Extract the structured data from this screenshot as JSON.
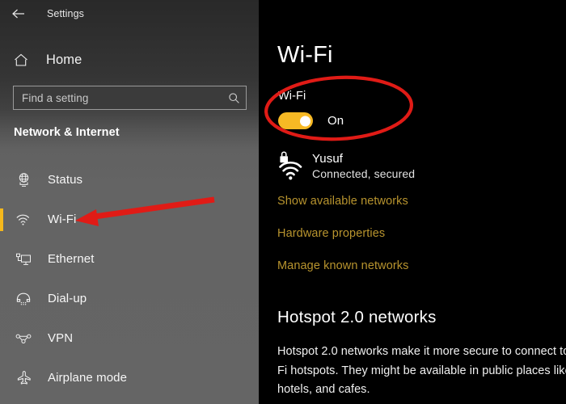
{
  "titlebar": {
    "back_icon": "back-arrow-icon",
    "title": "Settings"
  },
  "sidebar": {
    "home": {
      "label": "Home",
      "icon": "home-icon"
    },
    "search": {
      "placeholder": "Find a setting",
      "value": "",
      "icon": "search-icon"
    },
    "section_title": "Network & Internet",
    "accent_color": "#f5b81c",
    "items": [
      {
        "label": "Status",
        "icon": "globe-monitor-icon",
        "selected": false
      },
      {
        "label": "Wi-Fi",
        "icon": "wifi-signal-icon",
        "selected": true
      },
      {
        "label": "Ethernet",
        "icon": "ethernet-monitor-icon",
        "selected": false
      },
      {
        "label": "Dial-up",
        "icon": "phone-handset-icon",
        "selected": false
      },
      {
        "label": "VPN",
        "icon": "vpn-network-icon",
        "selected": false
      },
      {
        "label": "Airplane mode",
        "icon": "airplane-icon",
        "selected": false
      }
    ]
  },
  "panel": {
    "title": "Wi-Fi",
    "wifi_toggle": {
      "label": "Wi-Fi",
      "state_label": "On",
      "on": true,
      "color": "#f7b924"
    },
    "network": {
      "icon": "wifi-locked-icon",
      "name": "Yusuf",
      "status": "Connected, secured"
    },
    "links": [
      "Show available networks",
      "Hardware properties",
      "Manage known networks"
    ],
    "link_color": "#b8942e",
    "hotspot": {
      "title": "Hotspot 2.0 networks",
      "body": "Hotspot 2.0 networks make it more secure to connect to public Wi-Fi hotspots. They might be available in public places like airports, hotels, and cafes."
    }
  },
  "annotations": {
    "color": "#e01b16",
    "ellipse": {
      "label": "red-ellipse-around-wifi-toggle"
    },
    "arrow": {
      "label": "red-arrow-pointing-to-wifi-nav-item"
    }
  }
}
